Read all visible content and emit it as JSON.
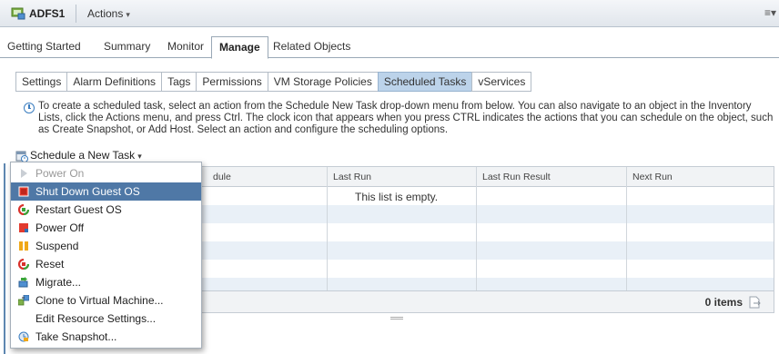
{
  "titlebar": {
    "vm_name": "ADFS1",
    "actions_label": "Actions",
    "caret": "▾"
  },
  "main_tabs": [
    "Getting Started",
    "Summary",
    "Monitor",
    "Manage",
    "Related Objects"
  ],
  "sub_tabs": [
    "Settings",
    "Alarm Definitions",
    "Tags",
    "Permissions",
    "VM Storage Policies",
    "Scheduled Tasks",
    "vServices"
  ],
  "info_text": "To create a scheduled task, select an action from the Schedule New Task drop-down menu from below. You can also navigate to an object in the Inventory Lists, click the Actions menu, and press Ctrl. The clock icon that appears when you press CTRL indicates the actions that you can schedule on the object, such as Create Snapshot, or Add Host. Select an action and configure the scheduling options.",
  "schedule_button": "Schedule a New Task",
  "grid": {
    "columns": [
      "dule",
      "Last Run",
      "Last Run Result",
      "Next Run"
    ],
    "empty_text": "This list is empty.",
    "items_count": "0 items"
  },
  "menu": {
    "items": [
      {
        "label": "Power On",
        "icon": "power-on-icon",
        "state": "disabled"
      },
      {
        "label": "Shut Down Guest OS",
        "icon": "shutdown-icon",
        "state": "selected"
      },
      {
        "label": "Restart Guest OS",
        "icon": "restart-icon",
        "state": "normal"
      },
      {
        "label": "Power Off",
        "icon": "power-off-icon",
        "state": "normal"
      },
      {
        "label": "Suspend",
        "icon": "suspend-icon",
        "state": "normal"
      },
      {
        "label": "Reset",
        "icon": "reset-icon",
        "state": "normal"
      },
      {
        "label": "Migrate...",
        "icon": "migrate-icon",
        "state": "normal"
      },
      {
        "label": "Clone to Virtual Machine...",
        "icon": "clone-icon",
        "state": "normal"
      },
      {
        "label": "Edit Resource Settings...",
        "icon": "none",
        "state": "normal"
      },
      {
        "label": "Take Snapshot...",
        "icon": "snapshot-icon",
        "state": "normal"
      }
    ]
  },
  "colors": {
    "accent": "#4f78a6",
    "active_subtab": "#bcd3ea",
    "row_alt": "#e9f0f7"
  }
}
